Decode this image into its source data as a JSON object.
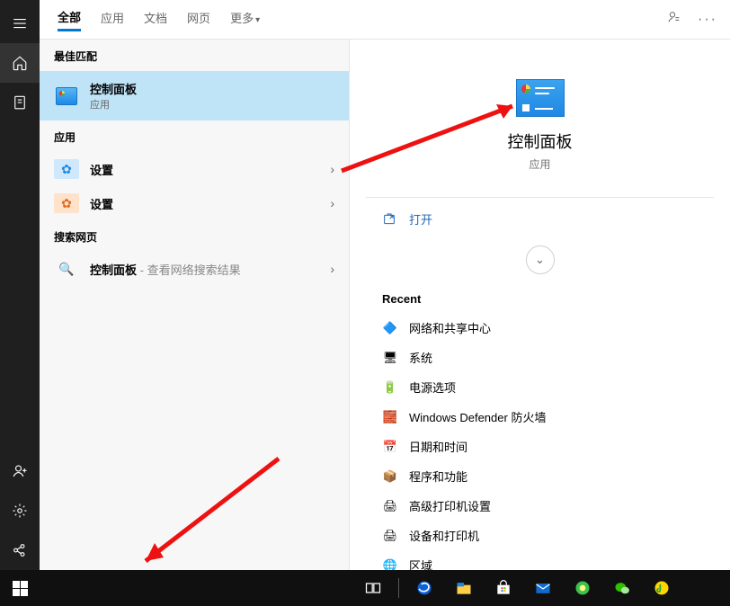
{
  "tabs": {
    "all": "全部",
    "apps": "应用",
    "docs": "文档",
    "web": "网页",
    "more": "更多"
  },
  "groups": {
    "best_match": "最佳匹配",
    "apps": "应用",
    "web": "搜索网页"
  },
  "best": {
    "title": "控制面板",
    "sub": "应用"
  },
  "app_items": [
    {
      "title": "设置"
    },
    {
      "title": "设置"
    }
  ],
  "web_item": {
    "title": "控制面板",
    "suffix": " - 查看网络搜索结果"
  },
  "detail": {
    "title": "控制面板",
    "sub": "应用",
    "open": "打开",
    "recent_header": "Recent",
    "recent": [
      "网络和共享中心",
      "系统",
      "电源选项",
      "Windows Defender 防火墙",
      "日期和时间",
      "程序和功能",
      "高级打印机设置",
      "设备和打印机",
      "区域"
    ]
  },
  "search": {
    "value": "控制面板"
  }
}
